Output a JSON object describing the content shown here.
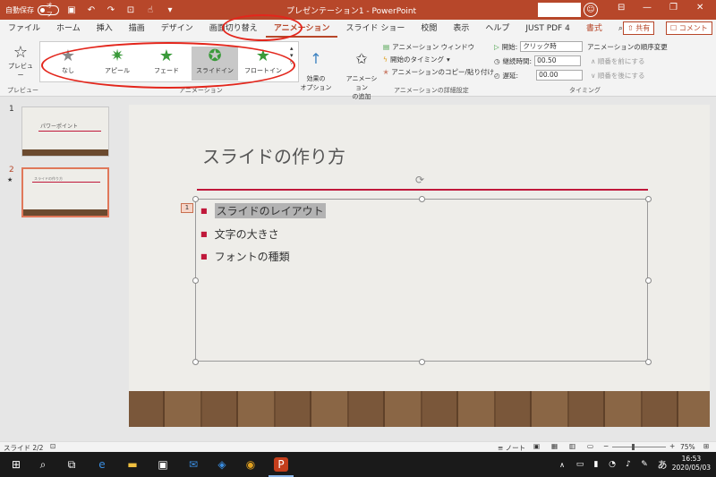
{
  "titlebar": {
    "autosave": "自動保存",
    "toggle": "オフ",
    "doc_title": "プレゼンテーション1  -  PowerPoint"
  },
  "tabs": [
    "ファイル",
    "ホーム",
    "挿入",
    "描画",
    "デザイン",
    "画面切り替え",
    "アニメーション",
    "スライド ショー",
    "校閲",
    "表示",
    "ヘルプ",
    "JUST PDF 4",
    "書式",
    "検索"
  ],
  "share": "共有",
  "comment": "コメント",
  "ribbon": {
    "preview": "プレビュー",
    "preview_group": "プレビュー",
    "animations": [
      "なし",
      "アピール",
      "フェード",
      "スライドイン",
      "フロートイン"
    ],
    "anim_group": "アニメーション",
    "effect_options": "効果の\nオプション",
    "add_anim": "アニメーション\nの追加",
    "anim_window": "アニメーション ウィンドウ",
    "trigger": "開始のタイミング",
    "painter": "アニメーションのコピー/貼り付け",
    "adv_group": "アニメーションの詳細設定",
    "start_label": "開始:",
    "start_value": "クリック時",
    "duration_label": "継続時間:",
    "duration_value": "00.50",
    "delay_label": "遅延:",
    "delay_value": "00.00",
    "reorder": "アニメーションの順序変更",
    "move_earlier": "順番を前にする",
    "move_later": "順番を後にする",
    "timing_group": "タイミング"
  },
  "thumbs": [
    {
      "num": "1",
      "title": "パワーポイント"
    },
    {
      "num": "2",
      "title": "スライドの作り方"
    }
  ],
  "slide": {
    "title": "スライドの作り方",
    "anim_tag": "1",
    "bullets": [
      "スライドのレイアウト",
      "文字の大きさ",
      "フォントの種類"
    ]
  },
  "status": {
    "slide": "スライド 2/2",
    "notes": "ノート",
    "zoom": "75%"
  },
  "taskbar": {
    "time": "16:53",
    "date": "2020/05/03",
    "ime": "あ"
  }
}
